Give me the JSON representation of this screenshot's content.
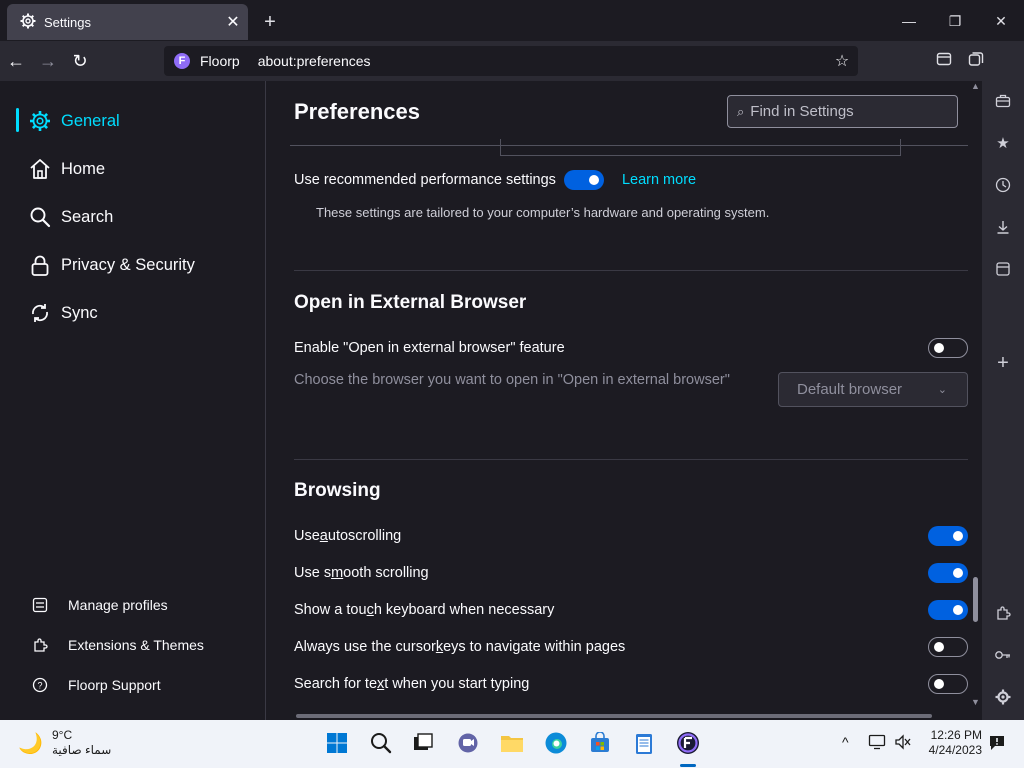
{
  "browser": {
    "tab_title": "Settings",
    "tab_close": "✕",
    "new_tab": "+",
    "identity_label": "Floorp",
    "url": "about:preferences",
    "window_controls": {
      "minimize": "—",
      "maximize": "❐",
      "close": "✕"
    }
  },
  "sidebar": {
    "categories": [
      {
        "label": "General",
        "icon": "gear-icon",
        "selected": true
      },
      {
        "label": "Home",
        "icon": "home-icon"
      },
      {
        "label": "Search",
        "icon": "search-icon"
      },
      {
        "label": "Privacy & Security",
        "icon": "lock-icon"
      },
      {
        "label": "Sync",
        "icon": "sync-icon"
      }
    ],
    "footer": [
      {
        "label": "Manage profiles",
        "icon": "profiles-icon"
      },
      {
        "label": "Extensions & Themes",
        "icon": "puzzle-icon"
      },
      {
        "label": "Floorp Support",
        "icon": "help-icon"
      }
    ]
  },
  "main": {
    "title": "Preferences",
    "find_placeholder": "Find in Settings",
    "performance": {
      "label": "Use recommended performance settings",
      "enabled": true,
      "learn_more": "Learn more",
      "description": "These settings are tailored to your computer’s hardware and operating system."
    },
    "external_browser": {
      "title": "Open in External Browser",
      "enable_label": "Enable \"Open in external browser\" feature",
      "enabled": false,
      "choose_label": "Choose the browser you want to open in \"Open in external browser\"",
      "select_value": "Default browser"
    },
    "browsing": {
      "title": "Browsing",
      "autoscroll": {
        "pre": "Use ",
        "u": "a",
        "post": "utoscrolling",
        "enabled": true
      },
      "smooth": {
        "pre": "Use s",
        "u": "m",
        "post": "ooth scrolling",
        "enabled": true
      },
      "touch": {
        "pre": "Show a tou",
        "u": "c",
        "post": "h keyboard when necessary",
        "enabled": true
      },
      "cursor": {
        "pre": "Always use the cursor ",
        "u": "k",
        "post": "eys to navigate within pages",
        "enabled": false
      },
      "find_typing": {
        "pre": "Search for te",
        "u": "x",
        "post": "t when you start typing",
        "enabled": false
      }
    }
  },
  "taskbar": {
    "temperature": "9°C",
    "weather_text": "سماء صافية",
    "time": "12:26 PM",
    "date": "4/24/2023"
  },
  "colors": {
    "accent": "#00ddff",
    "toggle_on": "#0061e0",
    "background": "#1c1b22"
  }
}
